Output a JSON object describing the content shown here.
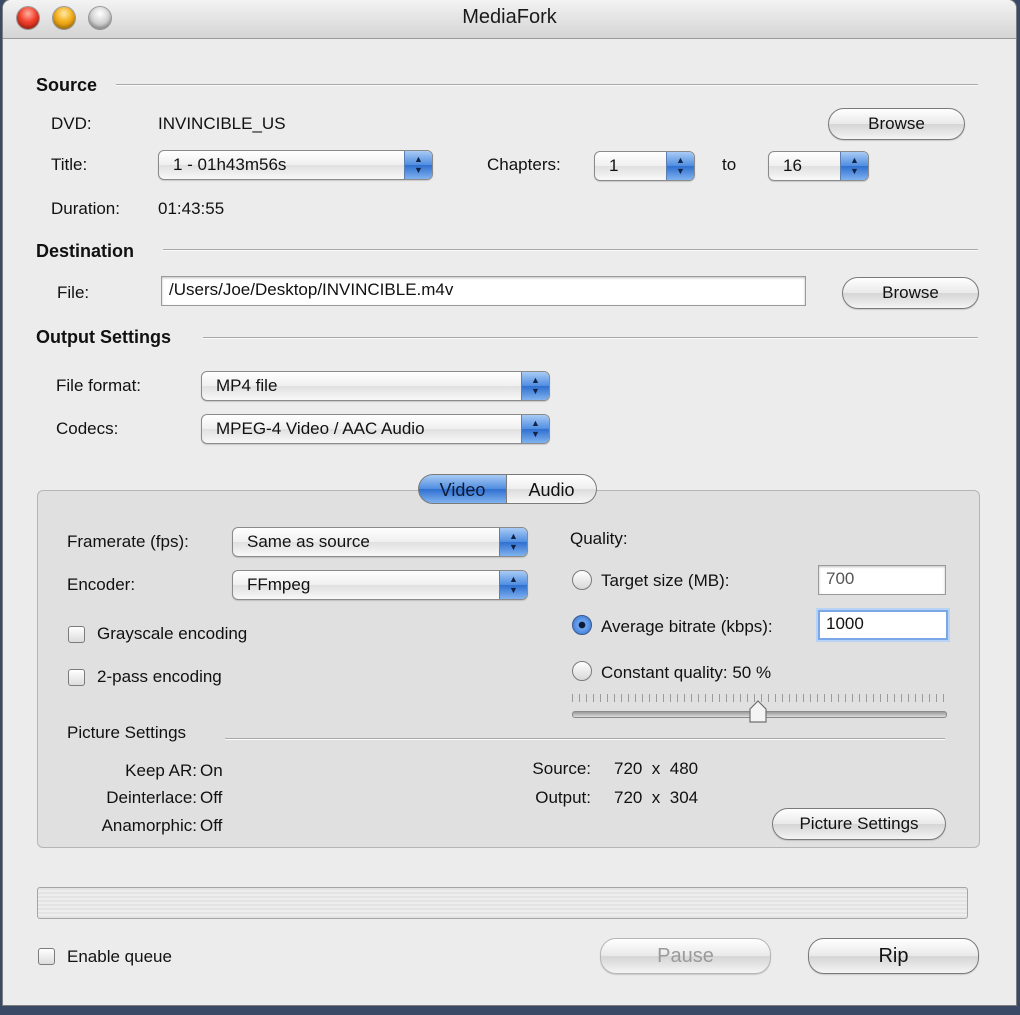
{
  "window": {
    "title": "MediaFork"
  },
  "source": {
    "heading": "Source",
    "dvd_label": "DVD:",
    "dvd_value": "INVINCIBLE_US",
    "browse": "Browse",
    "title_label": "Title:",
    "title_value": "1 - 01h43m56s",
    "chapters_label": "Chapters:",
    "chapter_start": "1",
    "to_label": "to",
    "chapter_end": "16",
    "duration_label": "Duration:",
    "duration_value": "01:43:55"
  },
  "destination": {
    "heading": "Destination",
    "file_label": "File:",
    "file_value": "/Users/Joe/Desktop/INVINCIBLE.m4v",
    "browse": "Browse"
  },
  "output": {
    "heading": "Output Settings",
    "format_label": "File format:",
    "format_value": "MP4 file",
    "codecs_label": "Codecs:",
    "codecs_value": "MPEG-4 Video / AAC Audio"
  },
  "tabs": {
    "video": "Video",
    "audio": "Audio",
    "active": "Video"
  },
  "video": {
    "framerate_label": "Framerate (fps):",
    "framerate_value": "Same as source",
    "encoder_label": "Encoder:",
    "encoder_value": "FFmpeg",
    "grayscale": {
      "label": "Grayscale encoding",
      "checked": false
    },
    "twopass": {
      "label": "2-pass encoding",
      "checked": false
    },
    "quality": {
      "label": "Quality:",
      "target_label": "Target size (MB):",
      "target_value": "700",
      "bitrate_label": "Average bitrate (kbps):",
      "bitrate_value": "1000",
      "constant_label": "Constant quality: 50 %",
      "selected": "bitrate",
      "slider_value": 0.5
    },
    "picture": {
      "heading": "Picture Settings",
      "keep_ar_label": "Keep AR:",
      "keep_ar_value": "On",
      "deinterlace_label": "Deinterlace:",
      "deinterlace_value": "Off",
      "anamorphic_label": "Anamorphic:",
      "anamorphic_value": "Off",
      "source_label": "Source:",
      "source_value": "720  x  480",
      "output_label": "Output:",
      "output_value": "720  x  304",
      "button": "Picture Settings"
    }
  },
  "footer": {
    "queue_label": "Enable queue",
    "queue_checked": false,
    "pause": "Pause",
    "rip": "Rip",
    "progress": 0
  },
  "colors": {
    "accent": "#4f8de0",
    "window_bg": "#ececec"
  }
}
